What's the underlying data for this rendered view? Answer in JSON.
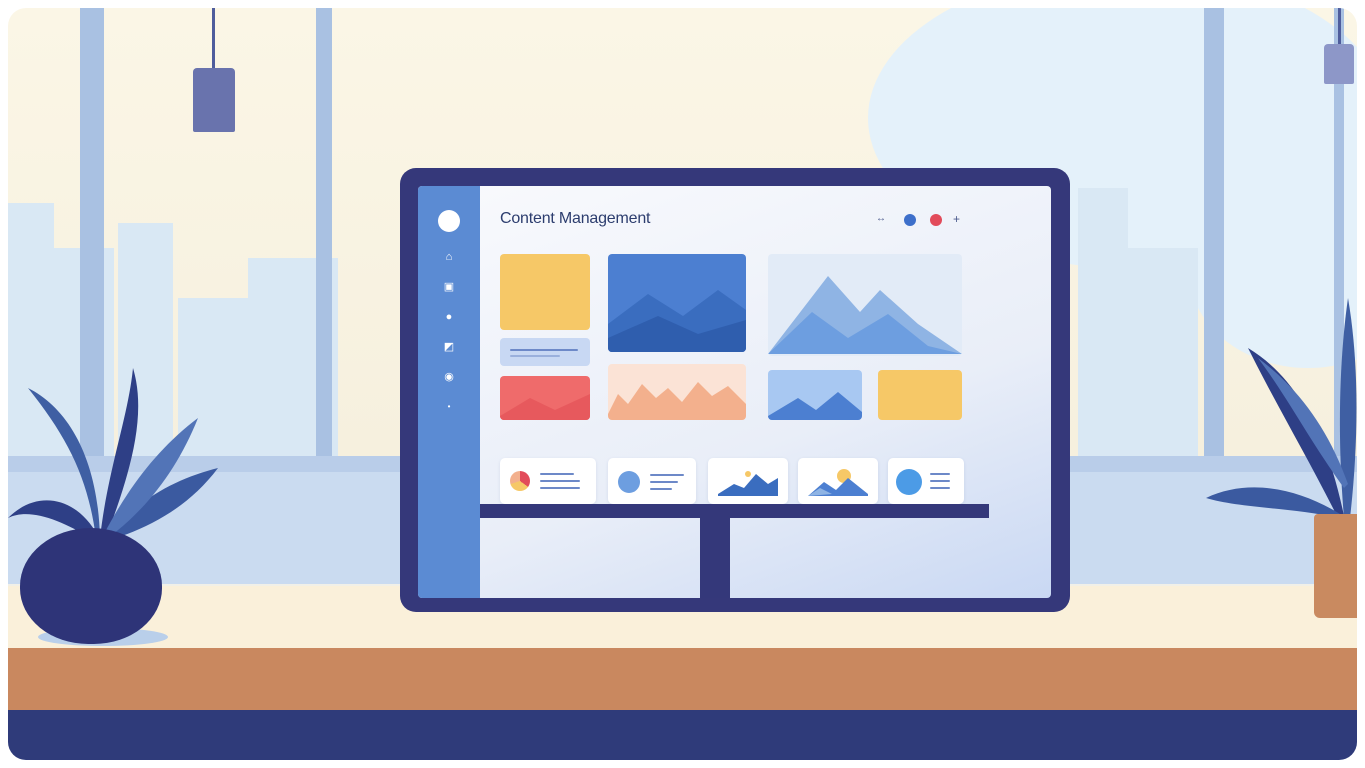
{
  "app": {
    "title": "Content Management"
  },
  "icons": {
    "sidebar": [
      "logo-icon",
      "home-icon",
      "document-icon",
      "circle-icon",
      "folder-icon",
      "settings-icon",
      "dot-icon"
    ],
    "header": [
      "expand-icon",
      "user-icon",
      "notification-icon",
      "add-icon"
    ]
  },
  "colors": {
    "sidebar": "#5b8bd3",
    "title": "#2c3d6e",
    "accent_yellow": "#f6c867",
    "accent_blue": "#4c7fd1",
    "accent_red": "#ef6b6b",
    "accent_peach": "#f3b08d",
    "desk": "#c9885f",
    "floor": "#2f3b7a"
  }
}
